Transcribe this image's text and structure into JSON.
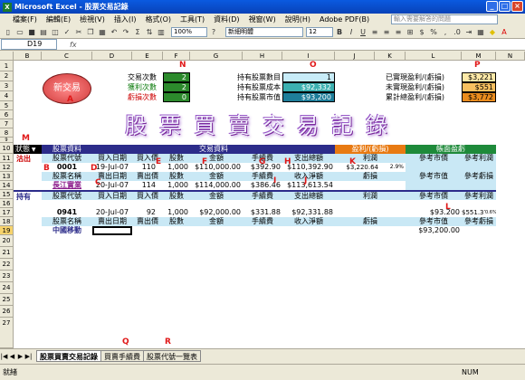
{
  "window": {
    "title": "Microsoft Excel - 股票交易記錄"
  },
  "menu": [
    "檔案(F)",
    "編輯(E)",
    "檢視(V)",
    "插入(I)",
    "格式(O)",
    "工具(T)",
    "資料(D)",
    "視窗(W)",
    "說明(H)",
    "Adobe PDF(B)"
  ],
  "help_placeholder": "輸入需要解答的問題",
  "toolbar": {
    "font": "新細明體",
    "size": "12",
    "zoom": "100%"
  },
  "formula": {
    "namebox": "D19",
    "fx": "fx"
  },
  "columns": [
    "B",
    "C",
    "D",
    "E",
    "F",
    "G",
    "H",
    "I",
    "J",
    "K",
    "L",
    "M",
    "N"
  ],
  "rows": [
    "1",
    "2",
    "3",
    "4",
    "5",
    "6",
    "7",
    "8",
    "9",
    "10",
    "11",
    "12",
    "13",
    "14",
    "15",
    "16",
    "17",
    "18",
    "19",
    "20",
    "21",
    "22",
    "23",
    "24",
    "25",
    "26",
    "27"
  ],
  "summary": {
    "new_trade": "新交易",
    "counts": [
      {
        "label": "交易次數",
        "value": "2"
      },
      {
        "label": "獲利次數",
        "value": "2"
      },
      {
        "label": "虧損次數",
        "value": "0"
      }
    ],
    "hold": [
      {
        "label": "持有股票數目",
        "value": "1"
      },
      {
        "label": "持有股票成本",
        "value": "$92,332"
      },
      {
        "label": "持有股票市值",
        "value": "$93,200"
      }
    ],
    "pl": [
      {
        "label": "已實現盈利/(虧損)",
        "value": "$3,221"
      },
      {
        "label": "未實現盈利/(虧損)",
        "value": "$551"
      },
      {
        "label": "累計總盈利/(虧損)",
        "value": "$3,772"
      }
    ]
  },
  "banner": "股票買賣交易記錄",
  "table": {
    "status_hdr": "狀態",
    "stock_info": "股票資料",
    "trade_info": "交易資料",
    "pl_hdr": "盈利/(虧損)",
    "book_hdr": "帳面盈虧",
    "hdr1": [
      "股票代號",
      "買入日期",
      "買入價",
      "股數",
      "金額",
      "手續費",
      "支出總額",
      "利潤",
      "參考市價",
      "參考利潤"
    ],
    "hdr2": [
      "股票名稱",
      "賣出日期",
      "賣出價",
      "股數",
      "金額",
      "手續費",
      "收入淨額",
      "虧損",
      "參考市值",
      "參考虧損"
    ],
    "sold": {
      "status": "沽出",
      "code": "0001",
      "buy_date": "19-Jul-07",
      "buy_price": "110",
      "shares": "1,000",
      "amount": "$110,000.00",
      "fee": "$392.90",
      "total": "$110,392.90",
      "profit": "$3,220.64",
      "pct": "2.9%",
      "name": "長江實業",
      "sell_date": "20-Jul-07",
      "sell_price": "114",
      "shares2": "1,000",
      "amount2": "$114,000.00",
      "fee2": "$386.46",
      "net": "$113,613.54"
    },
    "held": {
      "status": "持有",
      "code": "0941",
      "buy_date": "20-Jul-07",
      "buy_price": "92",
      "shares": "1,000",
      "amount": "$92,000.00",
      "fee": "$331.88",
      "total": "$92,331.88",
      "mkt_price": "$93.200",
      "ref_profit": "$551.37",
      "pct": "0.6%",
      "name": "中國移動",
      "mkt_value": "$93,200.00"
    }
  },
  "labels": {
    "M": "M",
    "N": "N",
    "O": "O",
    "P": "P",
    "A": "A",
    "B": "B",
    "D": "D",
    "E": "E",
    "F": "F",
    "G": "G",
    "H": "H",
    "K": "K",
    "L": "L",
    "I": "I",
    "J": "J",
    "C": "C",
    "Q": "Q",
    "R": "R"
  },
  "sheets": [
    "股票買賣交易記錄",
    "買賣手續費",
    "股票代號一覽表"
  ],
  "status": {
    "left": "就緒",
    "right": "NUM"
  }
}
